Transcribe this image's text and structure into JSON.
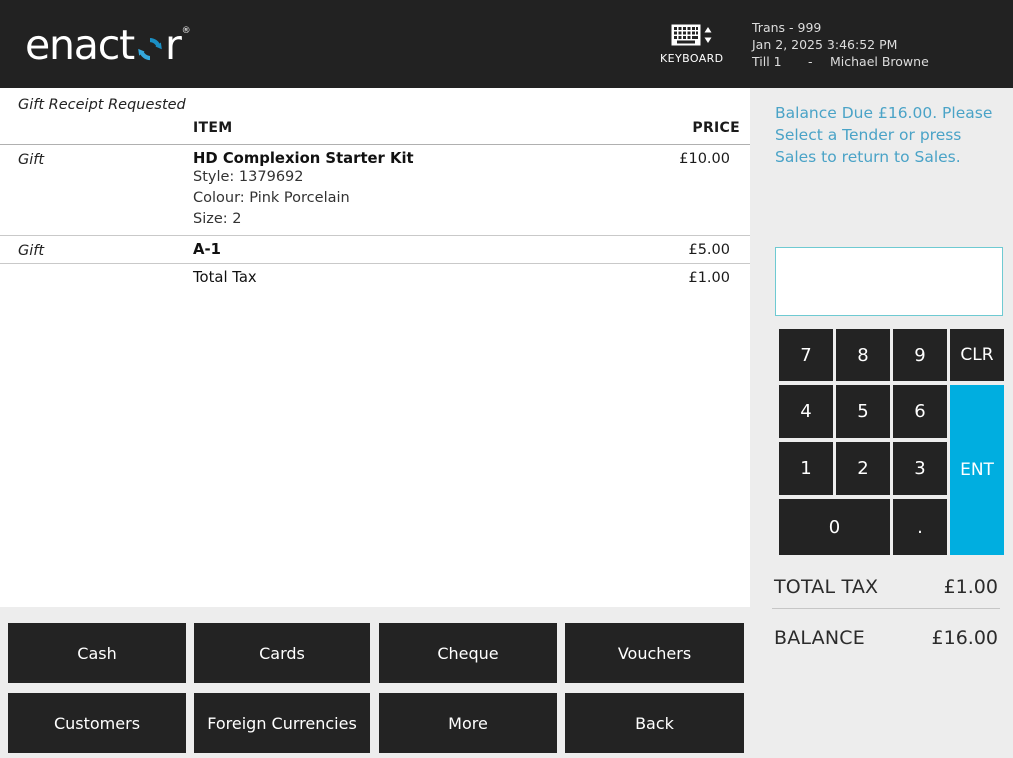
{
  "brand": {
    "name_part1": "enact",
    "name_part2": "r",
    "trademark": "®",
    "logo_icon": "circular-refresh-icon",
    "accent_color": "#00aee0"
  },
  "header": {
    "background": "#222222",
    "keyboard": {
      "icon": "keyboard-icon",
      "label": "KEYBOARD"
    },
    "transaction": {
      "trans_line": "Trans - 999",
      "datetime": "Jan 2, 2025 3:46:52 PM",
      "till": "Till 1",
      "separator": "-",
      "operator": "Michael Browne"
    }
  },
  "receipt": {
    "gift_receipt_note": "Gift Receipt Requested",
    "columns": {
      "item": "ITEM",
      "price": "PRICE"
    },
    "rows": [
      {
        "flag": "Gift",
        "name": "HD Complexion Starter Kit",
        "price": "£10.00",
        "bold": true,
        "attributes": [
          "Style: 1379692",
          "Colour: Pink Porcelain",
          "Size: 2"
        ]
      },
      {
        "flag": "Gift",
        "name": "A-1",
        "price": "£5.00",
        "bold": true,
        "attributes": []
      },
      {
        "flag": "",
        "name": "Total Tax",
        "price": "£1.00",
        "bold": false,
        "attributes": []
      }
    ]
  },
  "right_panel": {
    "background": "#ededed",
    "message": "Balance Due £16.00. Please Select a Tender or press Sales to return to Sales.",
    "message_color": "#4aa3c7",
    "amount_input": {
      "value": "",
      "placeholder": ""
    },
    "keypad": [
      {
        "label": "7",
        "name": "key-7",
        "accent": false
      },
      {
        "label": "8",
        "name": "key-8",
        "accent": false
      },
      {
        "label": "9",
        "name": "key-9",
        "accent": false
      },
      {
        "label": "CLR",
        "name": "key-clear",
        "accent": false
      },
      {
        "label": "4",
        "name": "key-4",
        "accent": false
      },
      {
        "label": "5",
        "name": "key-5",
        "accent": false
      },
      {
        "label": "6",
        "name": "key-6",
        "accent": false
      },
      {
        "label": "ENT",
        "name": "key-enter",
        "accent": true
      },
      {
        "label": "1",
        "name": "key-1",
        "accent": false
      },
      {
        "label": "2",
        "name": "key-2",
        "accent": false
      },
      {
        "label": "3",
        "name": "key-3",
        "accent": false
      },
      {
        "label": "0",
        "name": "key-0",
        "accent": false
      },
      {
        "label": ".",
        "name": "key-decimal",
        "accent": false
      }
    ],
    "totals": [
      {
        "label": "TOTAL TAX",
        "value": "£1.00"
      },
      {
        "label": "BALANCE",
        "value": "£16.00"
      }
    ]
  },
  "action_buttons": [
    {
      "label": "Cash",
      "name": "tender-button-cash"
    },
    {
      "label": "Cards",
      "name": "tender-button-cards"
    },
    {
      "label": "Cheque",
      "name": "tender-button-cheque"
    },
    {
      "label": "Vouchers",
      "name": "tender-button-vouchers"
    },
    {
      "label": "Customers",
      "name": "action-button-customers"
    },
    {
      "label": "Foreign Currencies",
      "name": "action-button-foreign-currencies"
    },
    {
      "label": "More",
      "name": "action-button-more"
    },
    {
      "label": "Back",
      "name": "action-button-back"
    }
  ]
}
